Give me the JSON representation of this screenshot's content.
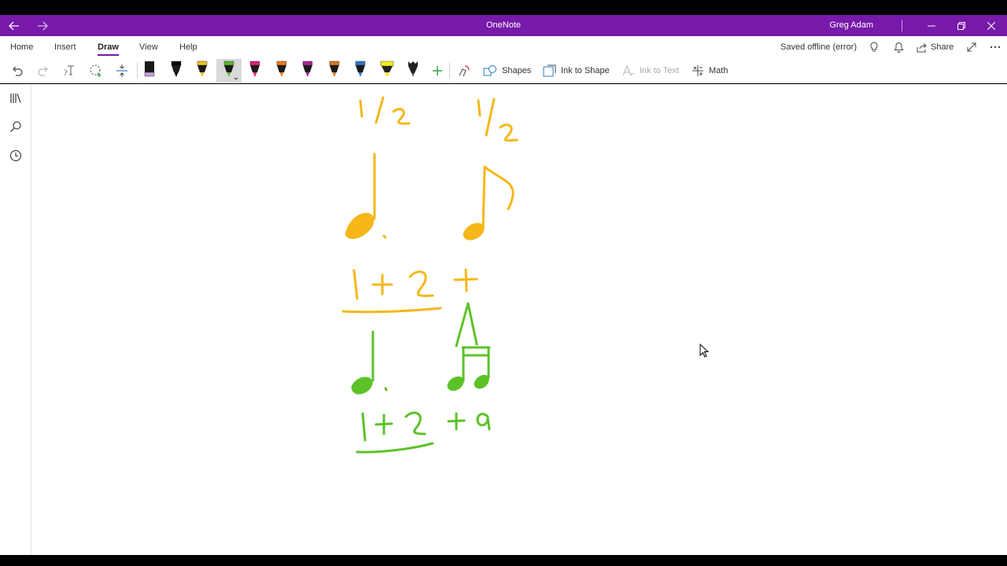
{
  "window": {
    "app_title": "OneNote",
    "user_name": "Greg Adam",
    "accent": "#7719aa"
  },
  "menu": {
    "tabs": [
      {
        "label": "Home"
      },
      {
        "label": "Insert"
      },
      {
        "label": "Draw"
      },
      {
        "label": "View"
      },
      {
        "label": "Help"
      }
    ],
    "active_tab": "Draw",
    "status": "Saved offline (error)",
    "share_label": "Share"
  },
  "toolbar": {
    "shapes_label": "Shapes",
    "ink_to_shape_label": "Ink to Shape",
    "ink_to_text_label": "Ink to Text",
    "math_label": "Math",
    "pens": [
      {
        "color": "#c8a0d8",
        "kind": "pen"
      },
      {
        "color": "#000000",
        "kind": "pen"
      },
      {
        "color": "#f2c21a",
        "kind": "pen"
      },
      {
        "color": "#58b82a",
        "kind": "pen",
        "selected": true
      },
      {
        "color": "#e3207a",
        "kind": "pen"
      },
      {
        "color": "#f07a1a",
        "kind": "pen"
      },
      {
        "color": "#b0209a",
        "kind": "pen"
      },
      {
        "color": "#e07820",
        "kind": "pen"
      },
      {
        "color": "#2a7ac8",
        "kind": "pen"
      },
      {
        "color": "#f5ea1a",
        "kind": "highlighter"
      },
      {
        "color": "#000000",
        "kind": "galaxy"
      }
    ]
  },
  "ink": {
    "yellow": "#f5b719",
    "green": "#5cc228"
  }
}
